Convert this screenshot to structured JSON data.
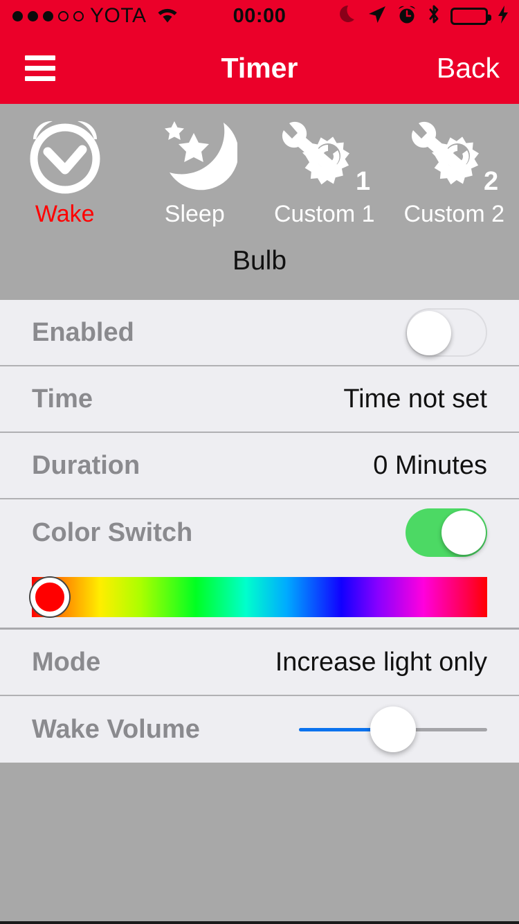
{
  "status_bar": {
    "signal_dots_filled": 3,
    "signal_dots_total": 5,
    "carrier": "YOTA",
    "wifi_icon": "wifi-icon",
    "time": "00:00",
    "icons": [
      "moon-icon",
      "location-arrow-icon",
      "alarm-clock-icon",
      "bluetooth-icon"
    ],
    "battery_icon": "battery-icon",
    "battery_level_percent": 100,
    "charging_icon": "lightning-bolt-icon",
    "background_color": "#EB0029",
    "foreground_color": "#0B0B0B"
  },
  "nav_bar": {
    "menu_icon": "hamburger-menu-icon",
    "title": "Timer",
    "back_label": "Back",
    "background_color": "#EB0029"
  },
  "tabs": {
    "panel_color": "#A8A8A8",
    "active_color": "#FF0000",
    "inactive_color": "#FFFFFF",
    "items": [
      {
        "label": "Wake",
        "icon": "alarm-clock-check-icon",
        "active": true
      },
      {
        "label": "Sleep",
        "icon": "moon-stars-icon",
        "active": false
      },
      {
        "label": "Custom 1",
        "icon": "wrench-gear-1-icon",
        "badge": "1",
        "active": false
      },
      {
        "label": "Custom 2",
        "icon": "wrench-gear-2-icon",
        "badge": "2",
        "active": false
      }
    ]
  },
  "device": {
    "name": "Bulb"
  },
  "settings": {
    "enabled": {
      "label": "Enabled",
      "state": "off"
    },
    "time": {
      "label": "Time",
      "value": "Time not set"
    },
    "duration": {
      "label": "Duration",
      "value": "0 Minutes"
    },
    "color_switch": {
      "label": "Color Switch",
      "state": "on",
      "on_color": "#4CD964"
    },
    "color_picker": {
      "selected_color": "#FF0000",
      "thumb_position_percent": 4
    },
    "mode": {
      "label": "Mode",
      "value": "Increase light only"
    },
    "wake_volume": {
      "label": "Wake Volume",
      "value_percent": 50,
      "fill_color": "#0A72EE",
      "track_color": "#A4A4A8"
    }
  }
}
